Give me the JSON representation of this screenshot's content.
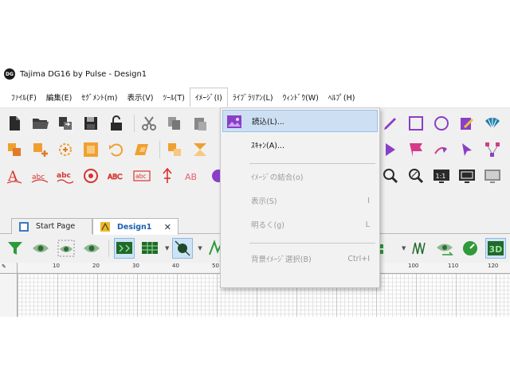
{
  "window": {
    "title": "Tajima DG16 by Pulse - Design1",
    "logo_text": "DG"
  },
  "menubar": {
    "items": [
      {
        "label": "ﾌｧｲﾙ(F)"
      },
      {
        "label": "編集(E)"
      },
      {
        "label": "ｾｸﾞﾒﾝﾄ(m)"
      },
      {
        "label": "表示(V)"
      },
      {
        "label": "ﾂｰﾙ(T)"
      },
      {
        "label": "ｲﾒｰｼﾞ(I)"
      },
      {
        "label": "ﾗｲﾌﾞﾗﾘｱﾝ(L)"
      },
      {
        "label": "ｳｨﾝﾄﾞｳ(W)"
      },
      {
        "label": "ﾍﾙﾌﾟ(H)"
      }
    ]
  },
  "dropdown": {
    "items": [
      {
        "label": "読込(L)...",
        "shortcut": ""
      },
      {
        "label": "ｽｷｬﾝ(A)...",
        "shortcut": ""
      },
      {
        "label": "ｲﾒｰｼﾞの結合(o)",
        "shortcut": ""
      },
      {
        "label": "表示(S)",
        "shortcut": "I"
      },
      {
        "label": "明るく(g)",
        "shortcut": "L"
      },
      {
        "label": "背景ｲﾒｰｼﾞ選択(B)",
        "shortcut": "Ctrl+I"
      }
    ]
  },
  "toolbar_row3": {
    "text_icons": [
      "abc",
      "abc",
      "ABC",
      "abc",
      "AB",
      "1:1",
      "3D"
    ]
  },
  "doc_tabs": [
    {
      "label": "Start Page"
    },
    {
      "label": "Design1",
      "close": "✕"
    }
  ],
  "ruler": {
    "corner_label": "✎",
    "labels": [
      "10",
      "20",
      "30",
      "40",
      "50",
      "100",
      "110",
      "120"
    ]
  },
  "colors": {
    "accent_purple": "#8a3fc7",
    "accent_orange": "#f0a030",
    "accent_red": "#d8322e",
    "accent_green": "#2e9a3a",
    "menu_highlight": "#cde0f3"
  },
  "icons": {
    "toolbar_row1": [
      "new-file-icon",
      "open-folder-icon",
      "import-icon",
      "save-icon",
      "lock-icon",
      "cut-icon",
      "copy-icon",
      "paste-icon"
    ],
    "toolbar_row1_right": [
      "pen-icon",
      "square-icon",
      "circle-icon",
      "edit-icon",
      "fan-icon"
    ],
    "toolbar_row2": [
      "stitch-icon",
      "add-icon",
      "rotate-icon",
      "select-icon",
      "undo-rotate-icon",
      "transform-icon",
      "group-icon",
      "split-icon"
    ],
    "toolbar_row2_right": [
      "arrow-icon",
      "flag-icon",
      "curve-arrow-icon",
      "cursor-icon",
      "nodes-icon"
    ],
    "toolbar_row3": [
      "text-a-icon",
      "text-abc-arc-icon",
      "text-abc-wave-icon",
      "text-circle-icon",
      "text-abc-outline-icon",
      "text-abc-box-icon",
      "text-vertical-icon",
      "text-ab-icon"
    ],
    "toolbar_row3_right": [
      "zoom-in-icon",
      "zoom-percent-icon",
      "zoom-1to1-icon",
      "fit-window-icon",
      "monitor-icon"
    ],
    "view_toolbar": [
      "filter-icon",
      "eye-icon",
      "eye-select-icon",
      "eye-show-icon",
      "grid-view-icon",
      "table-view-icon",
      "needle-icon",
      "stitch-view-icon",
      "tree-icon",
      "eye-arrow-icon",
      "speed-icon",
      "view-3d-icon"
    ]
  }
}
